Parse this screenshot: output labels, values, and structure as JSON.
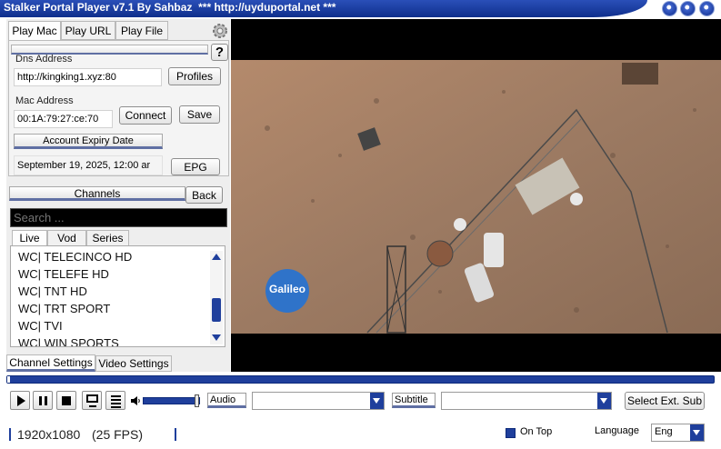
{
  "window": {
    "title": "Stalker Portal Player v7.1 By Sahbaz  *** http://uyduportal.net ***"
  },
  "tabs": [
    {
      "label": "Play Mac",
      "active": true
    },
    {
      "label": "Play URL",
      "active": false
    },
    {
      "label": "Play File",
      "active": false
    }
  ],
  "help_label": "?",
  "dns": {
    "label": "Dns Address",
    "value": "http://kingking1.xyz:80"
  },
  "profiles_label": "Profiles",
  "mac": {
    "label": "Mac Address",
    "value": "00:1A:79:27:ce:70"
  },
  "connect_label": "Connect",
  "save_label": "Save",
  "expiry": {
    "label": "Account Expiry Date",
    "value": "September 19, 2025, 12:00 ar"
  },
  "epg_label": "EPG",
  "channels_header": "Channels",
  "back_label": "Back",
  "search": {
    "placeholder": "Search ..."
  },
  "list_tabs": [
    {
      "label": "Live",
      "active": true
    },
    {
      "label": "Vod",
      "active": false
    },
    {
      "label": "Series",
      "active": false
    }
  ],
  "channels": [
    "WC| TELECINCO HD",
    "WC| TELEFE HD",
    "WC| TNT HD",
    "WC| TRT SPORT",
    "WC| TVI",
    "WC| WIN SPORTS"
  ],
  "settings_tabs": [
    {
      "label": "Channel Settings",
      "active": true
    },
    {
      "label": "Video Settings",
      "active": false
    }
  ],
  "video": {
    "watermark": "Galileo"
  },
  "controls": {
    "audio_label": "Audio",
    "subtitle_label": "Subtitle",
    "select_ext_sub_label": "Select Ext. Sub"
  },
  "status": {
    "resolution": "1920x1080",
    "fps": "(25 FPS)",
    "on_top_label": "On Top",
    "language_label": "Language",
    "language_value": "Eng"
  },
  "colors": {
    "accent": "#1f3f9c",
    "title_blue": "#143494",
    "video_bg": "#000000",
    "desert": "#9c7a60"
  }
}
